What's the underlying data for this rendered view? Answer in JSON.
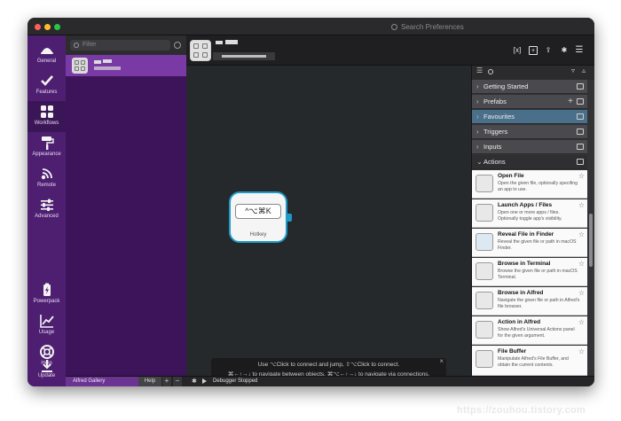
{
  "titlebar": {
    "search_placeholder": "Search Preferences"
  },
  "sidebar": {
    "items": [
      {
        "label": "General",
        "icon": "alfred-hat-icon"
      },
      {
        "label": "Features",
        "icon": "checkmark-icon"
      },
      {
        "label": "Workflows",
        "icon": "grid-icon"
      },
      {
        "label": "Appearance",
        "icon": "paint-roller-icon"
      },
      {
        "label": "Remote",
        "icon": "remote-icon"
      },
      {
        "label": "Advanced",
        "icon": "sliders-icon"
      },
      {
        "label": "Powerpack",
        "icon": "battery-icon"
      },
      {
        "label": "Usage",
        "icon": "line-chart-icon"
      },
      {
        "label": "Help",
        "icon": "lifebuoy-icon"
      },
      {
        "label": "Update",
        "icon": "download-icon"
      }
    ]
  },
  "workflow_list": {
    "filter_placeholder": "Filter"
  },
  "canvas": {
    "node": {
      "hotkey": "^⌥⌘K",
      "label": "Hotkey"
    },
    "hint_line1": "Use ⌥Click to connect and jump, ⇧⌥Click to connect.",
    "hint_line2": "⌘←↑→↓ to navigate between objects, ⌘⌥←↑→↓ to navigate via connections.",
    "hint_close": "×"
  },
  "bottom_bar": {
    "gallery": "Alfred Gallery",
    "help": "Help",
    "add": "+",
    "remove": "−",
    "debugger_status": "Debugger Stopped"
  },
  "objects_panel": {
    "categories": [
      {
        "label": "Getting Started"
      },
      {
        "label": "Prefabs"
      },
      {
        "label": "Favourites"
      },
      {
        "label": "Triggers"
      },
      {
        "label": "Inputs"
      },
      {
        "label": "Actions"
      }
    ],
    "actions": [
      {
        "title": "Open File",
        "desc": "Open the given file, optionally specifing an app to use."
      },
      {
        "title": "Launch Apps / Files",
        "desc": "Open one or more apps / files. Optionally toggle app's visibility."
      },
      {
        "title": "Reveal File in Finder",
        "desc": "Reveal the given file or path in macOS Finder."
      },
      {
        "title": "Browse in Terminal",
        "desc": "Browse the given file or path in macOS Terminal."
      },
      {
        "title": "Browse in Alfred",
        "desc": "Navigate the given file or path in Alfred's file browser."
      },
      {
        "title": "Action in Alfred",
        "desc": "Show Alfred's Universal Actions panel for the given argument."
      },
      {
        "title": "File Buffer",
        "desc": "Manipulate Alfred's File Buffer, and obtain the current contents."
      }
    ]
  },
  "watermark": "https://zouhou.tistory.com"
}
